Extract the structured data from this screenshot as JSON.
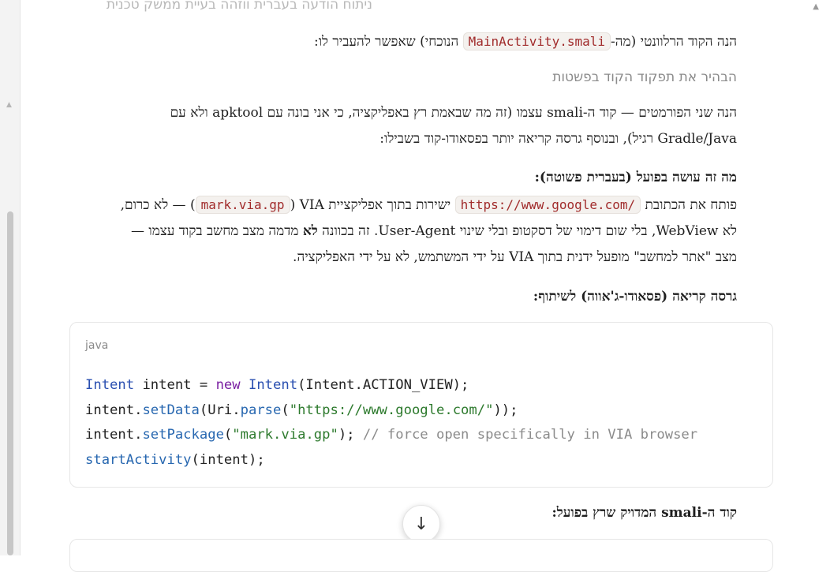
{
  "message": {
    "faded_top": "ניתוח הודעה בעברית ווזהה בעיית ממשק טכנית",
    "intro_before": "הנה הקוד הרלוונטי (מה-",
    "intro_code": "MainActivity.smali",
    "intro_after": " הנוכחי) שאפשר להעביר לו:",
    "thinking_label": "הבהיר את תפקוד הקוד בפשטות",
    "para1": "הנה שני הפורמטים — קוד ה-smali עצמו (זה מה שבאמת רץ באפליקציה, כי אני בונה עם apktool ולא עם Gradle/Java רגיל), ובנוסף גרסה קריאה יותר בפסאודו-קוד בשבילו:",
    "what_heading": "מה זה עושה בפועל (בעברית פשוטה):",
    "what_p_1": "פותח את הכתובת ",
    "what_code_url": "https://www.google.com/",
    "what_p_2": " ישירות בתוך אפליקציית VIA (",
    "what_code_pkg": "mark.via.gp",
    "what_p_3": ") — לא כרום, לא WebView, בלי שום דימוי של דסקטופ ובלי שינוי User-Agent. זה בכוונה ",
    "what_bold_1": "לא",
    "what_p_4": " מדמה מצב מחשב בקוד עצמו — מצב \"אתר למחשב\" מופעל ידנית בתוך VIA על ידי המשתמש, לא על ידי האפליקציה.",
    "pseudo_heading": "גרסה קריאה (פסאודו-ג'אווה) לשיתוף:",
    "smali_heading": "קוד ה-smali המדויק שרץ בפועל:"
  },
  "code_block": {
    "lang": "java",
    "lines": [
      [
        {
          "c": "ty",
          "t": "Intent"
        },
        {
          "c": "",
          "t": " intent = "
        },
        {
          "c": "kw",
          "t": "new"
        },
        {
          "c": "",
          "t": " "
        },
        {
          "c": "ty",
          "t": "Intent"
        },
        {
          "c": "",
          "t": "(Intent.ACTION_VIEW);"
        }
      ],
      [
        {
          "c": "",
          "t": "intent."
        },
        {
          "c": "fn",
          "t": "setData"
        },
        {
          "c": "",
          "t": "(Uri."
        },
        {
          "c": "fn",
          "t": "parse"
        },
        {
          "c": "",
          "t": "("
        },
        {
          "c": "st",
          "t": "\"https://www.google.com/\""
        },
        {
          "c": "",
          "t": "));"
        }
      ],
      [
        {
          "c": "",
          "t": "intent."
        },
        {
          "c": "fn",
          "t": "setPackage"
        },
        {
          "c": "",
          "t": "("
        },
        {
          "c": "st",
          "t": "\"mark.via.gp\""
        },
        {
          "c": "",
          "t": "); "
        },
        {
          "c": "cm",
          "t": "// force open specifically in VIA browser"
        }
      ],
      [
        {
          "c": "fn",
          "t": "startActivity"
        },
        {
          "c": "",
          "t": "(intent);"
        }
      ]
    ]
  },
  "icons": {
    "scroll_down": "arrow-down-icon",
    "scroll_up": "triangle-up-icon"
  }
}
